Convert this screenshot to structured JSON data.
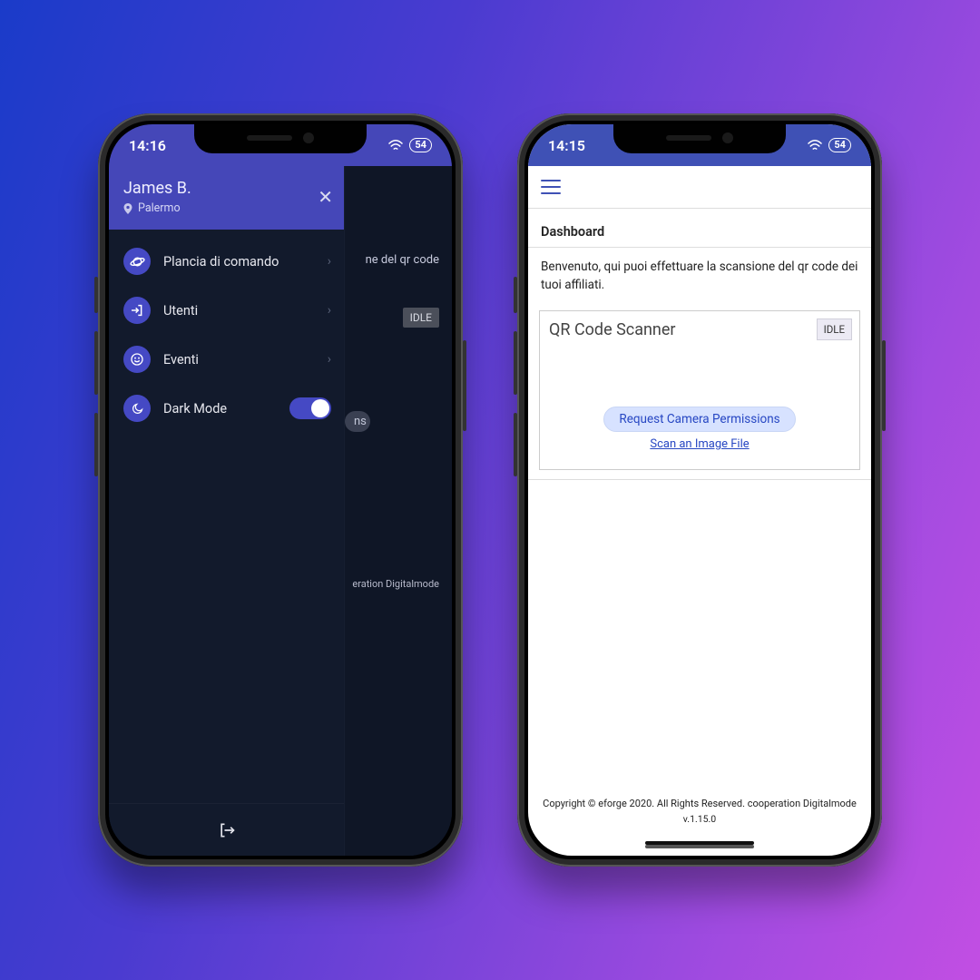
{
  "phone1": {
    "status": {
      "time": "14:16",
      "battery": "54"
    },
    "drawer": {
      "username": "James B.",
      "location": "Palermo",
      "items": [
        {
          "icon": "planet-icon",
          "label": "Plancia di comando",
          "hasChevron": true
        },
        {
          "icon": "logout-small-icon",
          "label": "Utenti",
          "hasChevron": true
        },
        {
          "icon": "smile-icon",
          "label": "Eventi",
          "hasChevron": true
        },
        {
          "icon": "moon-icon",
          "label": "Dark Mode",
          "hasToggle": true
        }
      ]
    },
    "behind": {
      "text_snippet": "ne del qr code",
      "idle": "IDLE",
      "pill_text": "ns",
      "footer_snippet": "eration Digitalmode"
    }
  },
  "phone2": {
    "status": {
      "time": "14:15",
      "battery": "54"
    },
    "dashboard": {
      "title": "Dashboard",
      "welcome": "Benvenuto, qui puoi effettuare la scansione del qr code dei tuoi affiliati.",
      "card": {
        "title": "QR Code Scanner",
        "idle": "IDLE",
        "perm_button": "Request Camera Permissions",
        "scan_link": "Scan an Image File"
      }
    },
    "footer": {
      "copyright": "Copyright © eforge 2020. All Rights Reserved. cooperation Digitalmode",
      "version": "v.1.15.0"
    }
  }
}
